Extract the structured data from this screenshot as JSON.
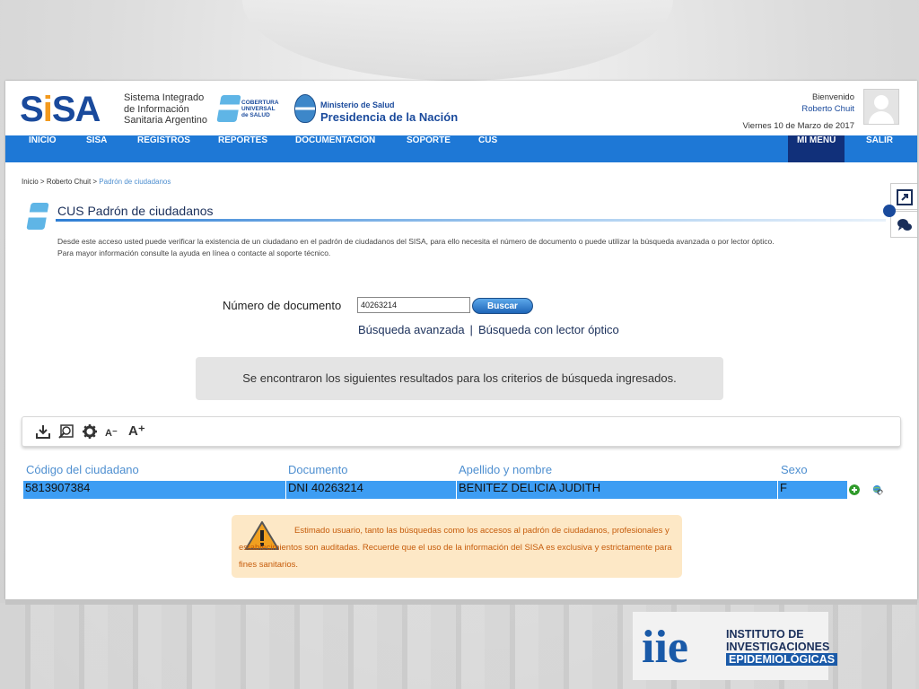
{
  "header": {
    "logo": "SISA",
    "subtitle_lines": [
      "Sistema Integrado",
      "de Información",
      "Sanitaria Argentino"
    ],
    "cus_logo_lines": [
      "COBERTURA",
      "UNIVERSAL",
      "de SALUD"
    ],
    "ministry_small": "Ministerio de Salud",
    "ministry_big": "Presidencia de la Nación",
    "welcome": "Bienvenido",
    "username": "Roberto Chuit",
    "date": "Viernes 10 de Marzo de 2017"
  },
  "nav": {
    "items": [
      "INICIO",
      "SISA",
      "REGISTROS",
      "REPORTES",
      "DOCUMENTACIÓN",
      "SOPORTE",
      "CUS"
    ],
    "menu": "MI MENÚ",
    "logout": "SALIR"
  },
  "breadcrumb": {
    "home": "Inicio",
    "user": "Roberto Chuit",
    "sep": " > ",
    "current": "Padrón de ciudadanos"
  },
  "section": {
    "title": "CUS Padrón de ciudadanos",
    "desc_lines": [
      "Desde este acceso usted puede verificar la existencia de un ciudadano en el padrón de ciudadanos del SISA, para ello necesita el número de documento o puede utilizar la búsqueda avanzada o por lector óptico.",
      "Para mayor información consulte la ayuda en línea o contacte al soporte técnico."
    ]
  },
  "search": {
    "label": "Número de documento",
    "value": "40263214",
    "button": "Buscar",
    "link_advanced": "Búsqueda avanzada",
    "link_separator": "|",
    "link_optical": "Búsqueda con lector óptico"
  },
  "result_message": "Se encontraron los siguientes resultados para los criterios de búsqueda ingresados.",
  "toolbar": {
    "icons": [
      "download-icon",
      "search-icon",
      "gear-icon",
      "font-decrease-icon",
      "font-increase-icon"
    ],
    "font_decrease": "A⁻",
    "font_increase": "A⁺"
  },
  "table": {
    "columns": [
      "Código del ciudadano",
      "Documento",
      "Apellido y nombre",
      "Sexo"
    ],
    "rows": [
      [
        "5813907384",
        "DNI 40263214",
        "BENITEZ DELICIA JUDITH",
        "F"
      ]
    ]
  },
  "warning": {
    "text": "Estimado usuario, tanto las búsquedas como los accesos al padrón de ciudadanos, profesionales y establecimientos son auditadas. Recuerde que el uso de la información del SISA es exclusiva y estrictamente para fines sanitarios."
  },
  "footer_logo": {
    "letters": "iie",
    "lines": [
      "INSTITUTO DE",
      "INVESTIGACIONES",
      "EPIDEMIOLÓGICAS"
    ]
  },
  "colors": {
    "nav": "#1e78d6",
    "menu": "#11307a",
    "row_highlight": "#3d9df3",
    "warning_bg": "#fde8c6",
    "warning_text": "#c65c0b",
    "brand_blue": "#1a4a9c",
    "brand_orange": "#f39a1e"
  }
}
